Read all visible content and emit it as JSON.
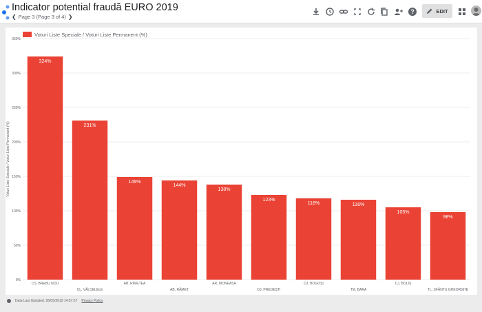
{
  "header": {
    "title": "Indicator potential fraudă EURO 2019",
    "page_info": "Page 3 (Page 3 of 4)",
    "prev_icon": "chevron-left-icon",
    "next_icon": "chevron-right-icon",
    "edit_label": "EDIT",
    "toolbar_icons": [
      "download-icon",
      "history-icon",
      "link-icon",
      "fullscreen-icon",
      "refresh-icon",
      "copy-icon",
      "share-icon",
      "help-icon",
      "edit-pencil-icon",
      "apps-grid-icon",
      "avatar-icon"
    ]
  },
  "footer": {
    "last_updated": "Data Last Updated: 26/05/2019 14:57:57",
    "privacy": "Privacy Policy"
  },
  "colors": {
    "bar": "#ea4335",
    "accent": "#4285f4"
  },
  "chart_data": {
    "type": "bar",
    "categories": [
      "CS, BREBU NOU",
      "CL, VĂLCELELE",
      "AB, RIMETEA",
      "AB, RÂMEȚ",
      "AR, MONEASA",
      "DJ, PREDEȘTI",
      "DJ, BOGOȘI",
      "TM, BARA",
      "CJ, BOLIȘ",
      "TL, SFÂNTU GHEORGHE"
    ],
    "series": [
      {
        "name": "Voturi Liste Speciale / Voturi Liste Permanent (%)",
        "values": [
          324,
          231,
          149,
          144,
          138,
          123,
          118,
          116,
          105,
          98
        ],
        "labels": [
          "324%",
          "231%",
          "149%",
          "144%",
          "138%",
          "123%",
          "118%",
          "116%",
          "105%",
          "98%"
        ]
      }
    ],
    "ylabel": "Voturi Liste Speciale / Voturi Liste Permanent (%)",
    "xlabel": "",
    "ylim": [
      0,
      350
    ],
    "yticks": [
      "0%",
      "50%",
      "100%",
      "150%",
      "200%",
      "250%",
      "300%",
      "350%"
    ],
    "grid": true,
    "legend": "top-left"
  }
}
